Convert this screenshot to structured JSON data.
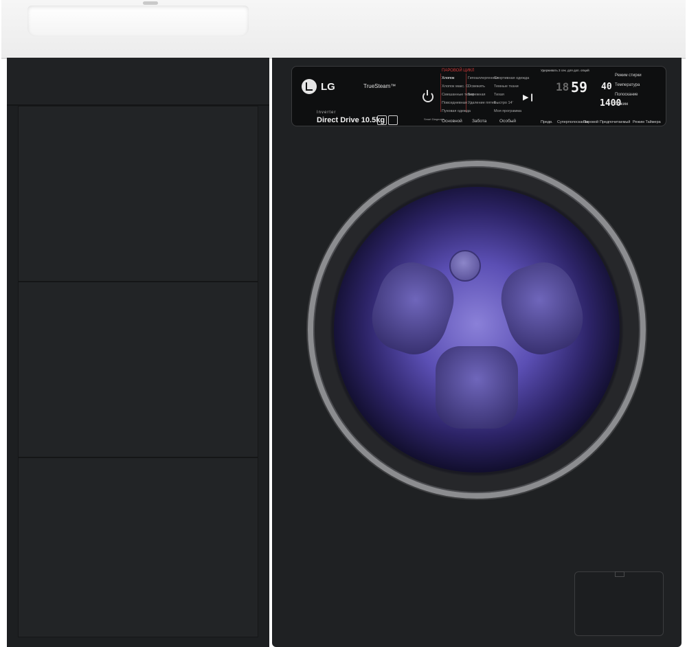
{
  "panel": {
    "brand": "LG",
    "truesteam": "TrueSteam™",
    "inverter": "Inverter",
    "direct_drive": "Direct Drive 10.5kg",
    "steam_cycle_header": "ПАРОВОЙ ЦИКЛ",
    "programs_col1": [
      "Хлопок",
      "Хлопок макс. С",
      "Смешанные ткани",
      "Повседневная",
      "Пуховая одежда"
    ],
    "programs_col2": [
      "Гипоаллергенная",
      "Освежить",
      "Бережная",
      "Удаление пятен"
    ],
    "programs_col3": [
      "Спортивная одежда",
      "Темные ткани",
      "Тихая",
      "Быстро 14'",
      "Моя программа"
    ],
    "categories": [
      "Основной",
      "Забота",
      "Особый"
    ],
    "smart_diagnosis": "Smart Diagnosis",
    "display_time": "59",
    "display_prefix": "18",
    "temperature": "40",
    "spin": "1400",
    "right_options": [
      "Режим стирки",
      "Температура",
      "Полоскание",
      "Отжим"
    ],
    "bottom_labels": [
      "Предв.",
      "Суперполоскание",
      "Паровой",
      "Предпочитаемый",
      "Режим Таймера"
    ],
    "note": "Удерживать 3 сек. для доп. опций"
  }
}
